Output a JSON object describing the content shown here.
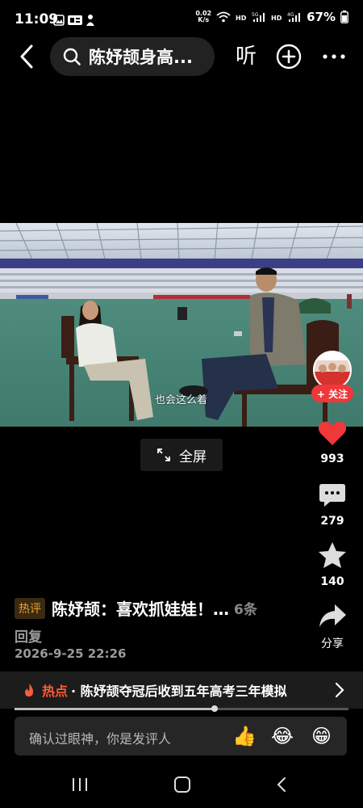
{
  "status": {
    "time": "11:09",
    "speed_value": "0.02",
    "speed_unit": "K/s",
    "battery": "67%"
  },
  "topbar": {
    "search_text": "陈妤颉身高...",
    "listen_label": "听"
  },
  "video": {
    "subtitle": "也会这么着"
  },
  "fullscreen": {
    "label": "全屏"
  },
  "side": {
    "follow_label": "+ 关注",
    "likes": "993",
    "comments": "279",
    "favorites": "140",
    "share_label": "分享"
  },
  "post": {
    "badge": "热评",
    "title": "陈妤颉：喜欢抓娃娃！…",
    "count": "6条",
    "reply": "回复",
    "date": "2026-9-25 22:26"
  },
  "hot": {
    "label": "热点",
    "text": "· 陈妤颉夺冠后收到五年高考三年模拟"
  },
  "progress": {
    "fraction": 0.6
  },
  "comment": {
    "placeholder": "确认过眼神，你是发评人",
    "emojis": [
      "👍",
      "😂",
      "😁"
    ]
  },
  "colors": {
    "accent": "#f0373a",
    "hot": "#ff5c3a",
    "badge": "#f0a02a"
  }
}
